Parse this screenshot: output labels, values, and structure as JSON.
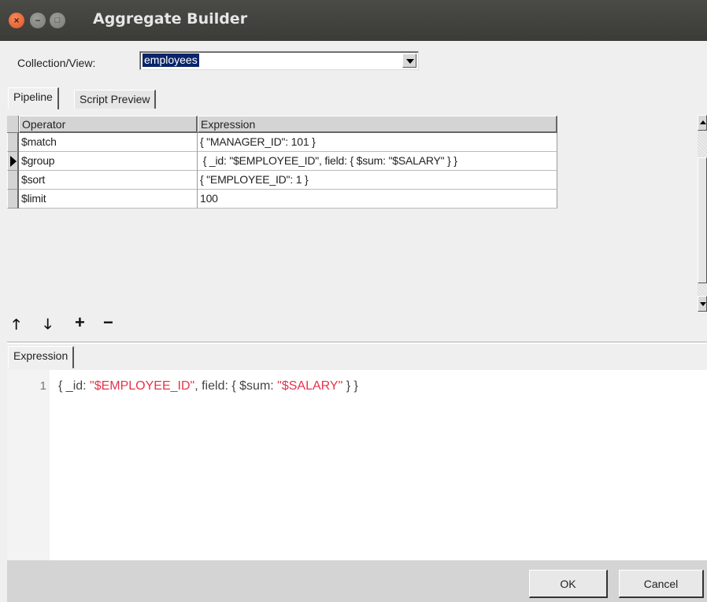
{
  "window": {
    "title": "Aggregate Builder",
    "close_glyph": "×",
    "min_glyph": "−",
    "max_glyph": "□"
  },
  "collection": {
    "label": "Collection/View:",
    "value": "employees"
  },
  "tabs": [
    {
      "label": "Pipeline",
      "active": true
    },
    {
      "label": "Script Preview",
      "active": false
    }
  ],
  "pipeline": {
    "columns": [
      "Operator",
      "Expression"
    ],
    "rows": [
      {
        "operator": "$match",
        "expression": "{ \"MANAGER_ID\": 101 }",
        "current": false
      },
      {
        "operator": "$group",
        "expression": " { _id: \"$EMPLOYEE_ID\", field: { $sum: \"$SALARY\" } }",
        "current": true
      },
      {
        "operator": "$sort",
        "expression": "{ \"EMPLOYEE_ID\": 1 }",
        "current": false
      },
      {
        "operator": "$limit",
        "expression": "100",
        "current": false
      }
    ]
  },
  "toolbar": {
    "move_up_icon": "arrow-up-icon",
    "move_down_icon": "arrow-down-icon",
    "add_icon": "plus-icon",
    "remove_icon": "minus-icon",
    "move_up_glyph": "🡑",
    "move_down_glyph": "🡓",
    "add_glyph": "+",
    "remove_glyph": "−"
  },
  "expression_tab": {
    "label": "Expression"
  },
  "editor": {
    "line_number": "1",
    "code_prefix": "{ _id: ",
    "code_str1": "\"$EMPLOYEE_ID\"",
    "code_mid": ", field: { $sum: ",
    "code_str2": "\"$SALARY\"",
    "code_suffix": " } }",
    "string_color": "#e5334b"
  },
  "buttons": {
    "ok": "OK",
    "cancel": "Cancel"
  }
}
